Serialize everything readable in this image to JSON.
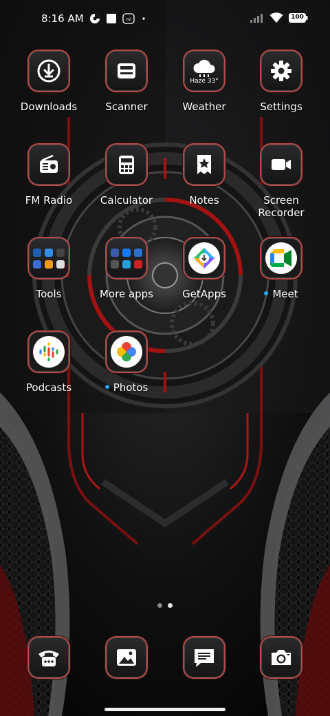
{
  "status_bar": {
    "time": "8:16 AM",
    "icons_left": [
      "notification-app-icon",
      "square-notification-icon",
      "mi-icon",
      "dot-icon"
    ],
    "icons_right": [
      "signal-icon",
      "wifi-icon",
      "battery-icon"
    ],
    "battery_label": "100"
  },
  "apps": [
    {
      "label": "Downloads",
      "icon": "download-icon"
    },
    {
      "label": "Scanner",
      "icon": "scanner-icon"
    },
    {
      "label": "Weather",
      "icon": "weather-cloud-icon",
      "weather_text": "Haze 33°"
    },
    {
      "label": "Settings",
      "icon": "gear-icon"
    },
    {
      "label": "FM Radio",
      "icon": "radio-icon"
    },
    {
      "label": "Calculator",
      "icon": "calculator-icon"
    },
    {
      "label": "Notes",
      "icon": "notes-star-icon"
    },
    {
      "label": "Screen\nRecorder",
      "label_line1": "Screen",
      "label_line2": "Recorder",
      "icon": "video-camera-icon"
    },
    {
      "label": "Tools",
      "icon": "folder-icon"
    },
    {
      "label": "More apps",
      "icon": "folder-icon"
    },
    {
      "label": "GetApps",
      "icon": "getapps-icon"
    },
    {
      "label": "Meet",
      "icon": "google-meet-icon",
      "new_dot": true
    },
    {
      "label": "Podcasts",
      "icon": "google-podcasts-icon"
    },
    {
      "label": "Photos",
      "icon": "google-photos-icon",
      "new_dot": true
    }
  ],
  "dock": [
    {
      "name": "phone",
      "icon": "phone-icon"
    },
    {
      "name": "gallery",
      "icon": "gallery-icon"
    },
    {
      "name": "messages",
      "icon": "message-icon"
    },
    {
      "name": "camera",
      "icon": "camera-icon"
    }
  ],
  "page_indicator": {
    "count": 2,
    "active": 2
  },
  "colors": {
    "accent_red": "#b24a4a",
    "new_dot": "#2aa7f0"
  }
}
